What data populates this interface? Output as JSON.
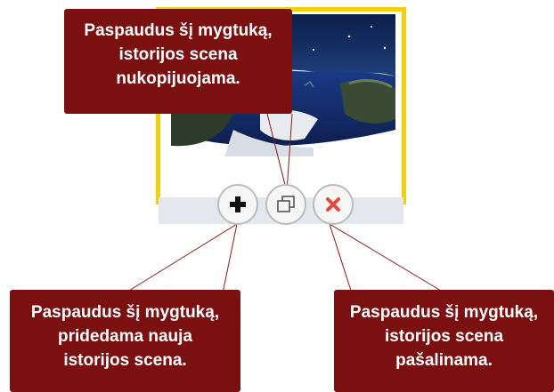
{
  "callouts": {
    "duplicate": [
      "Paspaudus šį mygtuką,",
      "istorijos scena",
      "nukopijuojama."
    ],
    "add": [
      "Paspaudus šį mygtuką,",
      "pridedama nauja",
      "istorijos scena."
    ],
    "delete": [
      "Paspaudus šį mygtuką,",
      "istorijos scena",
      "pašalinama."
    ]
  },
  "buttons": {
    "add_icon": "plus-icon",
    "duplicate_icon": "duplicate-icon",
    "delete_icon": "close-icon"
  },
  "colors": {
    "callout_bg": "#7b1010",
    "card_border": "#f2d10a",
    "delete_red": "#e04a3a",
    "pointer_line": "#8a1a1a"
  }
}
